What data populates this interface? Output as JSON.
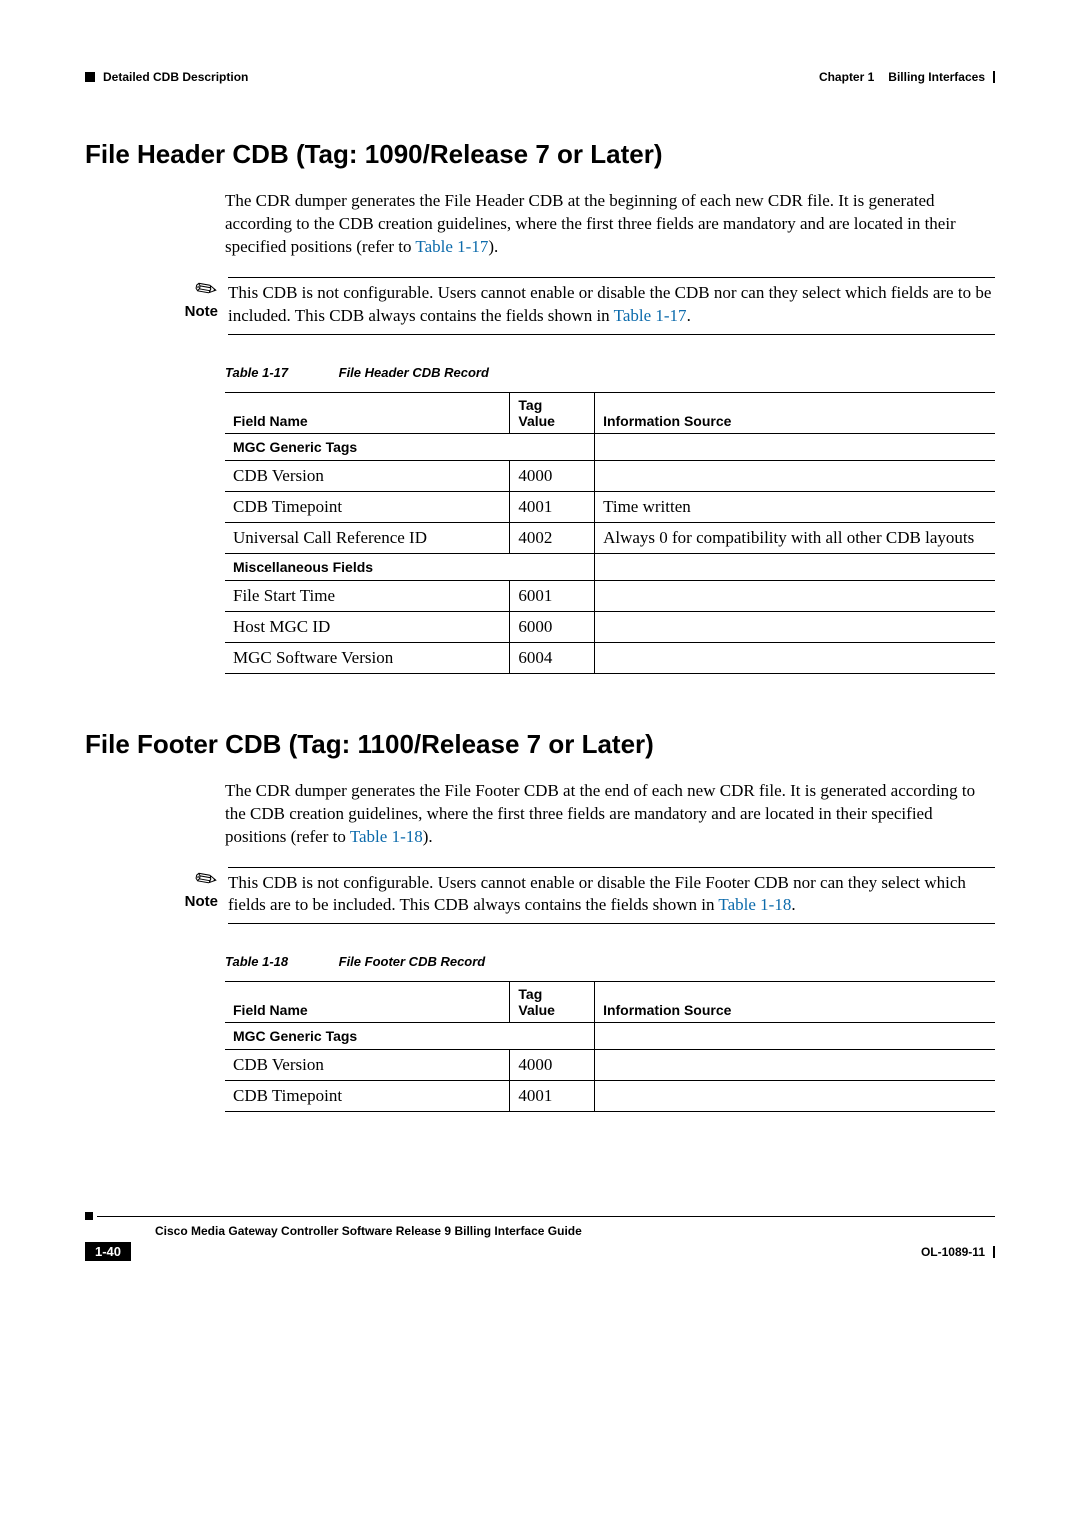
{
  "header": {
    "left": "Detailed CDB Description",
    "right_chapter": "Chapter 1",
    "right_title": "Billing Interfaces"
  },
  "section1": {
    "heading": "File Header CDB (Tag: 1090/Release 7 or Later)",
    "para1a": "The CDR dumper generates the File Header CDB at the beginning of each new CDR file. It is generated according to the CDB creation guidelines, where the first three fields are mandatory and are located in their specified positions (refer to ",
    "para1_link": "Table 1-17",
    "para1b": ").",
    "note_label": "Note",
    "note_a": "This CDB is not configurable. Users cannot enable or disable the CDB nor can they select which fields are to be included. This CDB always contains the fields shown in ",
    "note_link": "Table 1-17",
    "note_b": ".",
    "table_num": "Table 1-17",
    "table_title": "File Header CDB Record",
    "th_field": "Field Name",
    "th_tag1": "Tag",
    "th_tag2": "Value",
    "th_info": "Information Source",
    "sec1": "MGC Generic Tags",
    "rows1": [
      {
        "name": "CDB Version",
        "tag": "4000",
        "info": ""
      },
      {
        "name": "CDB Timepoint",
        "tag": "4001",
        "info": "Time written"
      },
      {
        "name": "Universal Call Reference ID",
        "tag": "4002",
        "info": "Always 0 for compatibility with all other CDB layouts"
      }
    ],
    "sec2": "Miscellaneous Fields",
    "rows2": [
      {
        "name": "File Start Time",
        "tag": "6001",
        "info": ""
      },
      {
        "name": "Host MGC ID",
        "tag": "6000",
        "info": ""
      },
      {
        "name": "MGC Software Version",
        "tag": "6004",
        "info": ""
      }
    ]
  },
  "section2": {
    "heading": "File Footer CDB (Tag: 1100/Release 7 or Later)",
    "para1a": "The CDR dumper generates the File Footer CDB at the end of each new CDR file. It is generated according to the CDB creation guidelines, where the first three fields are mandatory and are located in their specified positions (refer to ",
    "para1_link": "Table 1-18",
    "para1b": ").",
    "note_label": "Note",
    "note_a": "This CDB is not configurable. Users cannot enable or disable the File Footer CDB nor can they select which fields are to be included. This CDB always contains the fields shown in ",
    "note_link": "Table 1-18",
    "note_b": ".",
    "table_num": "Table 1-18",
    "table_title": "File Footer CDB Record",
    "th_field": "Field Name",
    "th_tag1": "Tag",
    "th_tag2": "Value",
    "th_info": "Information Source",
    "sec1": "MGC Generic Tags",
    "rows1": [
      {
        "name": "CDB Version",
        "tag": "4000",
        "info": ""
      },
      {
        "name": "CDB Timepoint",
        "tag": "4001",
        "info": ""
      }
    ]
  },
  "footer": {
    "guide": "Cisco Media Gateway Controller Software Release 9 Billing Interface Guide",
    "page": "1-40",
    "docid": "OL-1089-11"
  }
}
